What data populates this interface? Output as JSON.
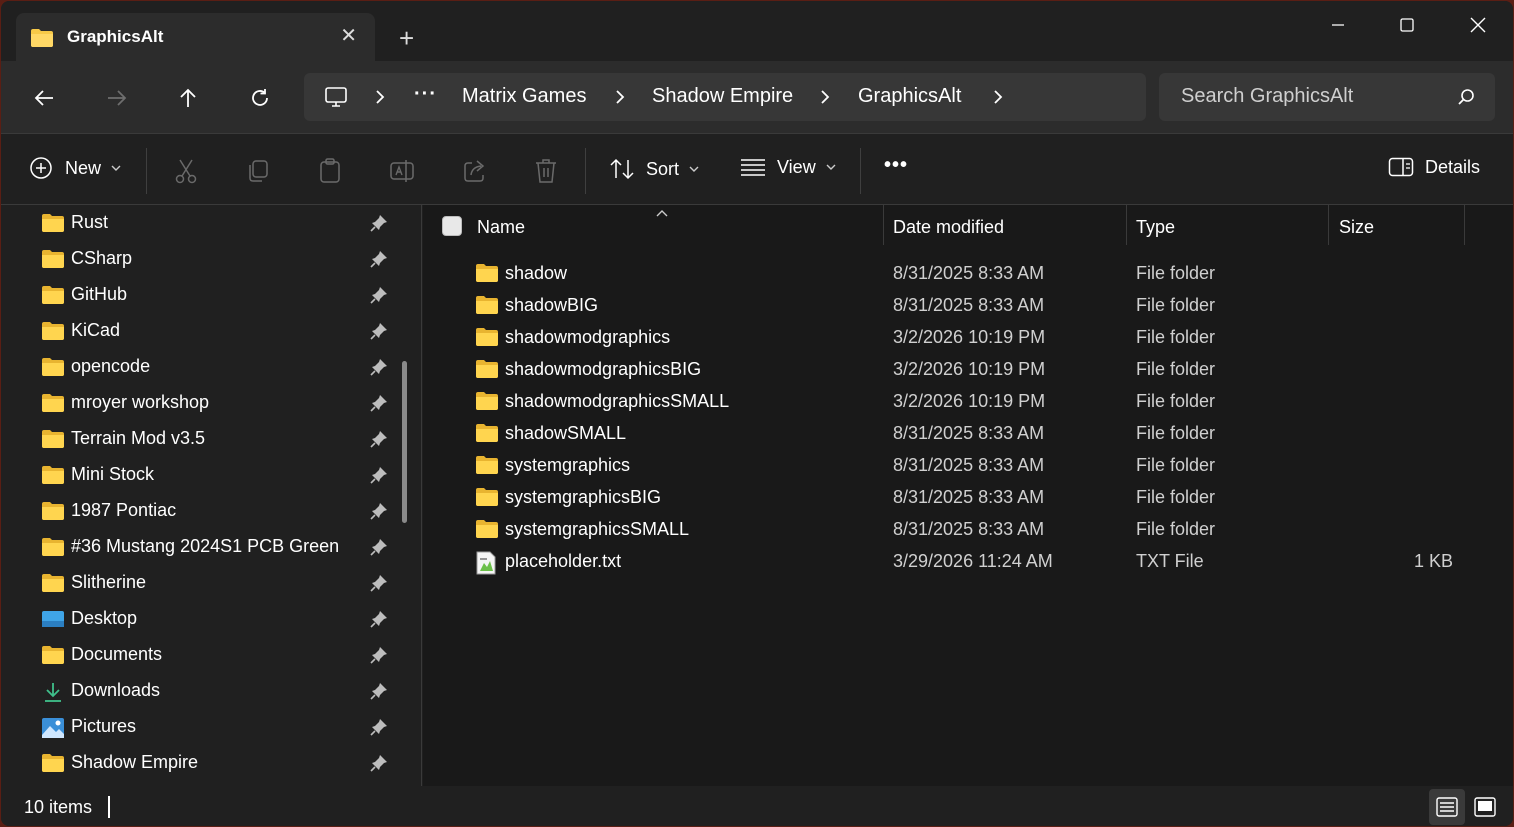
{
  "tab": {
    "title": "GraphicsAlt",
    "close": "✕",
    "new_tab": "+"
  },
  "address": {
    "ellipsis": "···",
    "crumbs": [
      "Matrix Games",
      "Shadow Empire",
      "GraphicsAlt"
    ]
  },
  "search": {
    "placeholder": "Search GraphicsAlt"
  },
  "commands": {
    "new": "New",
    "sort": "Sort",
    "view": "View",
    "more": "•••",
    "details": "Details"
  },
  "sidebar": {
    "items": [
      {
        "label": "Rust",
        "icon": "folder-icon"
      },
      {
        "label": "CSharp",
        "icon": "folder-icon"
      },
      {
        "label": "GitHub",
        "icon": "folder-icon"
      },
      {
        "label": "KiCad",
        "icon": "folder-icon"
      },
      {
        "label": "opencode",
        "icon": "folder-icon"
      },
      {
        "label": "mroyer workshop",
        "icon": "folder-icon"
      },
      {
        "label": "Terrain Mod v3.5",
        "icon": "folder-icon"
      },
      {
        "label": "Mini Stock",
        "icon": "folder-icon"
      },
      {
        "label": "1987 Pontiac",
        "icon": "folder-icon"
      },
      {
        "label": "#36 Mustang 2024S1 PCB Green",
        "icon": "folder-icon"
      },
      {
        "label": "Slitherine",
        "icon": "folder-icon"
      },
      {
        "label": "Desktop",
        "icon": "desktop-icon"
      },
      {
        "label": "Documents",
        "icon": "folder-icon"
      },
      {
        "label": "Downloads",
        "icon": "download-icon"
      },
      {
        "label": "Pictures",
        "icon": "pictures-icon"
      },
      {
        "label": "Shadow Empire",
        "icon": "folder-icon"
      }
    ]
  },
  "columns": {
    "name": "Name",
    "date": "Date modified",
    "type": "Type",
    "size": "Size"
  },
  "files": [
    {
      "name": "shadow",
      "date": "8/31/2025 8:33 AM",
      "type": "File folder",
      "size": "",
      "icon": "folder-icon"
    },
    {
      "name": "shadowBIG",
      "date": "8/31/2025 8:33 AM",
      "type": "File folder",
      "size": "",
      "icon": "folder-icon"
    },
    {
      "name": "shadowmodgraphics",
      "date": "3/2/2026 10:19 PM",
      "type": "File folder",
      "size": "",
      "icon": "folder-icon"
    },
    {
      "name": "shadowmodgraphicsBIG",
      "date": "3/2/2026 10:19 PM",
      "type": "File folder",
      "size": "",
      "icon": "folder-icon"
    },
    {
      "name": "shadowmodgraphicsSMALL",
      "date": "3/2/2026 10:19 PM",
      "type": "File folder",
      "size": "",
      "icon": "folder-icon"
    },
    {
      "name": "shadowSMALL",
      "date": "8/31/2025 8:33 AM",
      "type": "File folder",
      "size": "",
      "icon": "folder-icon"
    },
    {
      "name": "systemgraphics",
      "date": "8/31/2025 8:33 AM",
      "type": "File folder",
      "size": "",
      "icon": "folder-icon"
    },
    {
      "name": "systemgraphicsBIG",
      "date": "8/31/2025 8:33 AM",
      "type": "File folder",
      "size": "",
      "icon": "folder-icon"
    },
    {
      "name": "systemgraphicsSMALL",
      "date": "8/31/2025 8:33 AM",
      "type": "File folder",
      "size": "",
      "icon": "folder-icon"
    },
    {
      "name": "placeholder.txt",
      "date": "3/29/2026 11:24 AM",
      "type": "TXT File",
      "size": "1 KB",
      "icon": "text-file-icon"
    }
  ],
  "status": {
    "count": "10 items"
  },
  "colors": {
    "folder": "#f7c948",
    "window_bg": "#202020",
    "content_bg": "#191919",
    "accent_border": "#5a1e14"
  }
}
